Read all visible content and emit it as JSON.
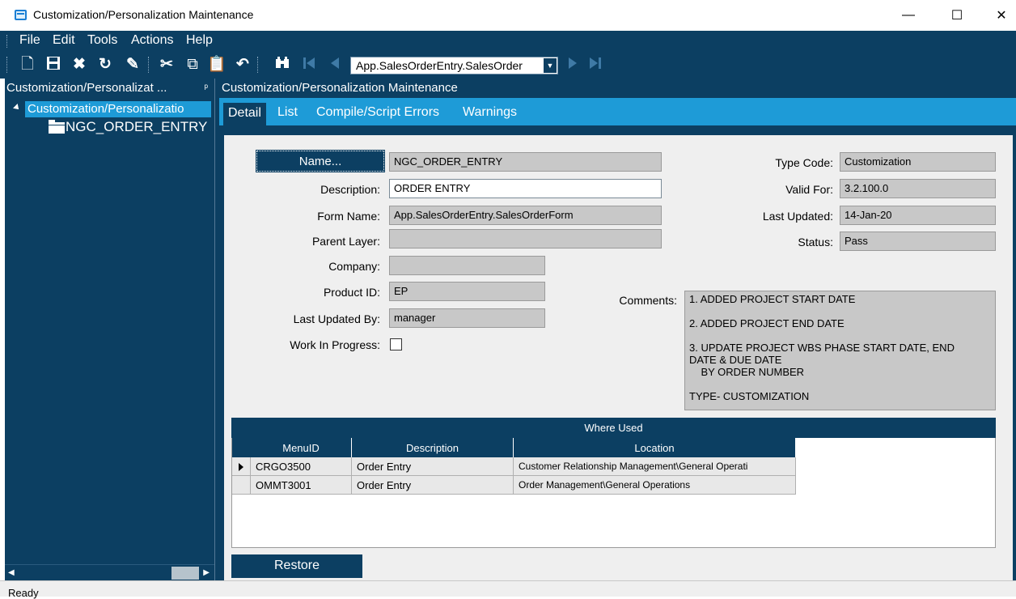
{
  "window": {
    "title": "Customization/Personalization Maintenance",
    "minimize": "—",
    "maximize": "☐",
    "close": "✕"
  },
  "menu": [
    "File",
    "Edit",
    "Tools",
    "Actions",
    "Help"
  ],
  "toolbar": {
    "icons": [
      "new-icon",
      "save-icon",
      "delete-icon",
      "refresh-icon",
      "clear-icon",
      "cut-icon",
      "copy-icon",
      "paste-icon",
      "undo-icon",
      "search-icon",
      "first-record-icon",
      "previous-record-icon",
      "next-record-icon",
      "last-record-icon"
    ],
    "form_combo_value": "App.SalesOrderEntry.SalesOrder"
  },
  "tree_panel": {
    "header": "Customization/Personalizat ...",
    "root": "Customization/Personalizatio",
    "child": "NGC_ORDER_ENTRY"
  },
  "main_panel": {
    "header": "Customization/Personalization Maintenance",
    "tabs": [
      "Detail",
      "List",
      "Compile/Script Errors",
      "Warnings"
    ],
    "active_tab": "Detail"
  },
  "form": {
    "name_button": "Name...",
    "name_value": "NGC_ORDER_ENTRY",
    "description_label": "Description:",
    "description_value": "ORDER ENTRY",
    "form_name_label": "Form Name:",
    "form_name_value": "App.SalesOrderEntry.SalesOrderForm",
    "parent_layer_label": "Parent Layer:",
    "parent_layer_value": "",
    "company_label": "Company:",
    "company_value": "",
    "product_id_label": "Product ID:",
    "product_id_value": "EP",
    "last_updated_by_label": "Last Updated By:",
    "last_updated_by_value": "manager",
    "work_in_progress_label": "Work In Progress:",
    "work_in_progress_checked": false,
    "type_code_label": "Type Code:",
    "type_code_value": "Customization",
    "valid_for_label": "Valid For:",
    "valid_for_value": "3.2.100.0",
    "last_updated_label": "Last Updated:",
    "last_updated_value": "14-Jan-20",
    "status_label": "Status:",
    "status_value": "Pass",
    "comments_label": "Comments:",
    "comments_lines": [
      "1. ADDED PROJECT START DATE",
      "",
      "2. ADDED PROJECT END DATE",
      "",
      "3. UPDATE PROJECT WBS PHASE START DATE, END",
      "DATE & DUE DATE",
      "    BY ORDER NUMBER",
      "",
      "TYPE- CUSTOMIZATION"
    ]
  },
  "where_used": {
    "title": "Where Used",
    "columns": [
      "MenuID",
      "Description",
      "Location"
    ],
    "rows": [
      {
        "menu_id": "CRGO3500",
        "description": "Order Entry",
        "location": "Customer Relationship Management\\General Operati"
      },
      {
        "menu_id": "OMMT3001",
        "description": "Order Entry",
        "location": "Order Management\\General Operations"
      }
    ]
  },
  "restore_button": "Restore",
  "status_bar": "Ready",
  "colors": {
    "navy": "#0c3f62",
    "accent_blue": "#1e9bd7",
    "form_bg": "#efefef",
    "readonly_field": "#c8c8c8"
  }
}
